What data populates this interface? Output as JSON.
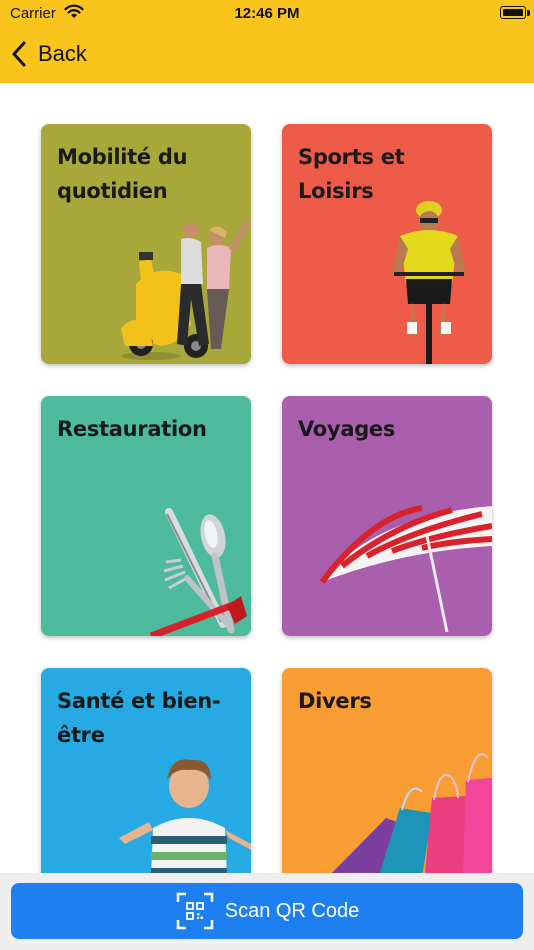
{
  "status_bar": {
    "carrier": "Carrier",
    "time": "12:46 PM"
  },
  "nav": {
    "back_label": "Back"
  },
  "categories": [
    {
      "title": "Mobilité du quotidien",
      "color": "#A8A73A"
    },
    {
      "title": "Sports et Loisirs",
      "color": "#EE5B48"
    },
    {
      "title": "Restauration",
      "color": "#4DBA9C"
    },
    {
      "title": "Voyages",
      "color": "#A95FAE"
    },
    {
      "title": "Santé et bien-être",
      "color": "#27AAE3"
    },
    {
      "title": "Divers",
      "color": "#F79D33"
    }
  ],
  "bottom": {
    "scan_label": "Scan QR Code"
  },
  "colors": {
    "header": "#F9C51C",
    "button": "#1E7FF0"
  }
}
